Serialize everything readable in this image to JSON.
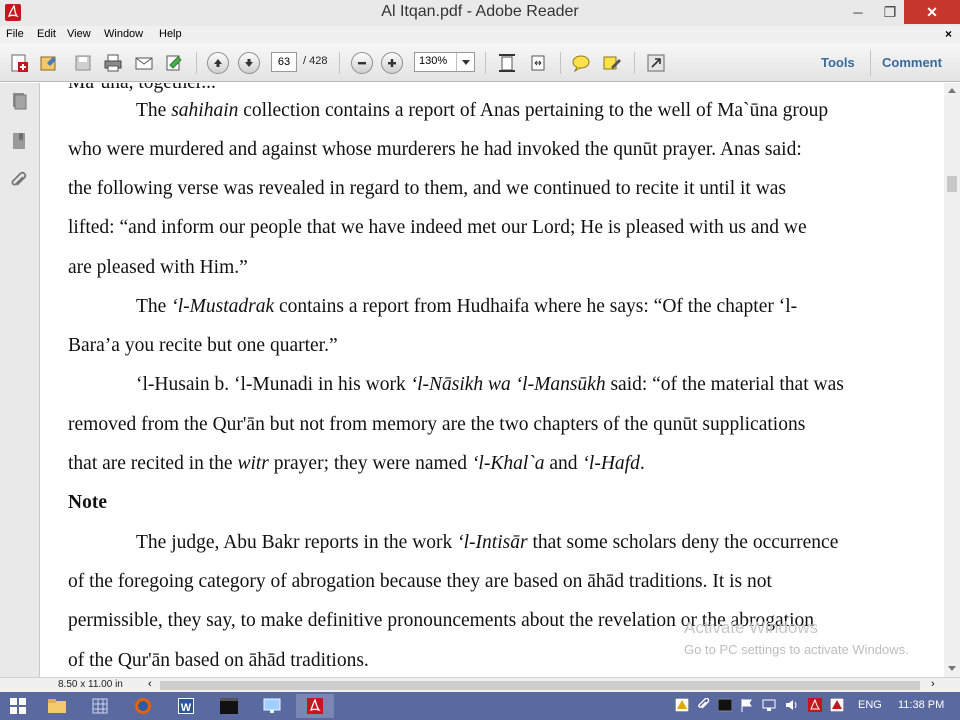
{
  "window": {
    "title": "Al Itqan.pdf - Adobe Reader",
    "min_glyph": "─",
    "max_glyph": "❐",
    "close_glyph": "✕"
  },
  "menu": {
    "items": [
      "File",
      "Edit",
      "View",
      "Window",
      "Help"
    ],
    "close_glyph": "×"
  },
  "toolbar": {
    "page_current": "63",
    "page_total": "/ 428",
    "zoom": "130%",
    "tools_label": "Tools",
    "comment_label": "Comment"
  },
  "document": {
    "cut_line": "Ma`ūna, together...",
    "p1": {
      "l1_a": "The ",
      "l1_i": "sahihain",
      "l1_b": " collection contains a report of Anas pertaining to the well of Ma`ūna group",
      "l2": "who were murdered and against whose murderers he had invoked the qunūt prayer. Anas said:",
      "l3": "the following verse was revealed in regard to them, and we continued to recite it until it was",
      "l4": "lifted: “and inform our people that we have indeed met our Lord; He is pleased with us and we",
      "l5": "are pleased with Him.”"
    },
    "p2": {
      "l1_a": "The ",
      "l1_i": "‘l-Mustadrak",
      "l1_b": " contains a report from Hudhaifa where he says: “Of the chapter ‘l-",
      "l2": "Bara’a you recite but one quarter.”"
    },
    "p3": {
      "l1_a": "‘l-Husain b. ‘l-Munadi in his work ",
      "l1_i": "‘l-Nāsikh wa ‘l-Mansūkh",
      "l1_b": " said: “of the material that was",
      "l2": "removed from the Qur'ān but not from memory are the two chapters of the qunūt supplications",
      "l3_a": "that are recited in the ",
      "l3_i1": "witr",
      "l3_b": " prayer; they were named ",
      "l3_i2": "‘l-Khal`a",
      "l3_c": " and ",
      "l3_i3": "‘l-Hafd",
      "l3_d": "."
    },
    "heading": "Note",
    "p4": {
      "l1_a": "The judge, Abu Bakr reports in the work ",
      "l1_i": "‘l-Intisār",
      "l1_b": " that some scholars deny the occurrence",
      "l2": "of the foregoing category of abrogation because they are based on āhād traditions. It is not",
      "l3": "permissible, they say, to make definitive pronouncements about the revelation or the abrogation",
      "l4": "of the Qur'ān based on āhād traditions."
    }
  },
  "watermark": {
    "line1": "Activate Windows",
    "line2": "Go to PC settings to activate Windows."
  },
  "statusbar": {
    "page_size": "8.50 x 11.00 in",
    "left_arrow": "‹",
    "right_arrow": "›"
  },
  "taskbar": {
    "language": "ENG",
    "time": "11:38 PM"
  }
}
